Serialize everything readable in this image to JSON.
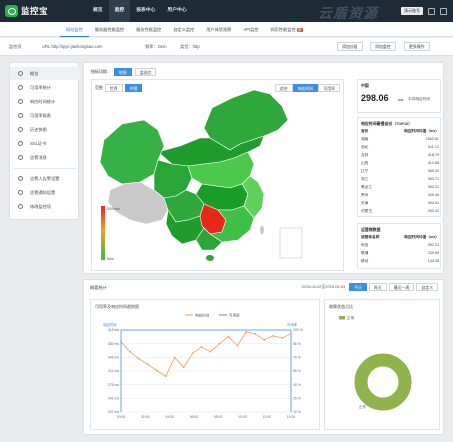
{
  "app": {
    "logo_text": "监控宝",
    "brand_right": "云盾资源"
  },
  "topnav": [
    "概览",
    "监控",
    "报表中心",
    "用户中心"
  ],
  "top_user": "演示账号",
  "subnav": {
    "tabs": [
      "网站监控",
      "服务器性能监控",
      "服务性能监控",
      "自定义监控",
      "用户体验观察",
      "API监控",
      "网页性能监控"
    ],
    "new_badge": "新"
  },
  "monitor_row": {
    "label": "监控项",
    "url": "URL:http://qiye.jiankongbao.com",
    "freq": "频率：2min",
    "type": "类型：http",
    "btn_add": "添加分组",
    "btn_monitor": "添加监控",
    "btn_more": "更多操作"
  },
  "sidebar": {
    "items": [
      {
        "label": "概览",
        "icon": "globe-icon"
      },
      {
        "label": "可用率统计",
        "icon": "chart-line-icon"
      },
      {
        "label": "响应时间统计",
        "icon": "clock-icon"
      },
      {
        "label": "可用率报表",
        "icon": "report-icon"
      },
      {
        "label": "历史快照",
        "icon": "history-icon"
      },
      {
        "label": "SSL证书",
        "icon": "lock-icon"
      },
      {
        "label": "告警消息",
        "icon": "bell-icon"
      },
      {
        "label": "告警人告警设置",
        "icon": "user-alert-icon"
      },
      {
        "label": "告警通知设置",
        "icon": "notify-icon"
      },
      {
        "label": "修改监控项",
        "icon": "edit-icon"
      }
    ]
  },
  "map_panel": {
    "view_label": "指标切换：",
    "view_tabs": [
      "地图",
      "监测点"
    ],
    "region_label": "范围",
    "region_tabs": [
      "世界",
      "中国"
    ],
    "metric_tabs": [
      "响应时间",
      "可用率"
    ],
    "metric_first": "综合",
    "legend_max": "5000ms",
    "legend_min": "5ms"
  },
  "stats": {
    "region": "中国",
    "avg_value": "298.06",
    "avg_unit": "ms",
    "avg_label": "平均响应时间",
    "top_title": "响应时间最慢省份（TOP10）",
    "col_province": "省份",
    "col_time": "响应时间均值（ms）",
    "rows": [
      [
        "湖南",
        "2362.61"
      ],
      [
        "西北",
        "511.12"
      ],
      [
        "吉林",
        "418.79"
      ],
      [
        "山西",
        "412.85"
      ],
      [
        "辽宁",
        "385.32"
      ],
      [
        "浙江",
        "353.71"
      ],
      [
        "黑龙江",
        "352.21"
      ],
      [
        "贵州",
        "339.45"
      ],
      [
        "天津",
        "304.01"
      ],
      [
        "内蒙古",
        "253.42"
      ]
    ],
    "isp_title": "运营商数据",
    "col_isp": "运营商名称",
    "isp_rows": [
      [
        "电信",
        "352.23"
      ],
      [
        "联通",
        "239.69"
      ],
      [
        "移动",
        "134.28"
      ]
    ]
  },
  "bottom": {
    "title": "概要统计",
    "date_range": "2015-04-02至2015-04-03",
    "range_tabs": [
      "今天",
      "昨天",
      "最近一周",
      "自定义"
    ],
    "chart_title": "可用率及响应时间趋势图",
    "legend_rt": "响应时间",
    "legend_av": "可用率",
    "left_axis_label": "响应时间",
    "right_axis_label": "可用率",
    "pie_title": "故障状态占比",
    "pie_legend": "正常",
    "pie_label": "正常"
  },
  "chart_data": [
    {
      "type": "line",
      "title": "可用率及响应时间趋势图",
      "x": [
        "00:00",
        "02:00",
        "04:00",
        "06:00",
        "08:00",
        "10:00",
        "12:00",
        "14:00"
      ],
      "series": [
        {
          "name": "响应时间",
          "values": [
            385,
            360,
            342,
            328,
            312,
            298,
            345,
            320,
            356,
            372,
            360,
            380,
            398,
            375,
            410,
            405,
            390,
            400,
            395,
            405
          ]
        },
        {
          "name": "可用率",
          "values": [
            100,
            100,
            100,
            100,
            100,
            100,
            100,
            100,
            100,
            100,
            100,
            100,
            100,
            100,
            100,
            100,
            100,
            100,
            100,
            100
          ]
        }
      ],
      "y_left_ticks": [
        "415 ms",
        "383 ms",
        "346 ms",
        "311 ms",
        "276 ms",
        "241 ms",
        "207 ms"
      ],
      "y_right_ticks": [
        "100 %",
        "85 %",
        "70 %",
        "55 %",
        "40 %",
        "25 %",
        "10 %"
      ],
      "ylim": [
        207,
        415
      ]
    },
    {
      "type": "pie",
      "title": "故障状态占比",
      "labels": [
        "正常"
      ],
      "values": [
        100
      ]
    }
  ],
  "colors": {
    "accent": "#3d8ee0",
    "green_dark": "#1a9c28",
    "green_light": "#4cc94a",
    "hot": "#e8261a",
    "line": "#f39a5c",
    "pie": "#8fb44b"
  }
}
